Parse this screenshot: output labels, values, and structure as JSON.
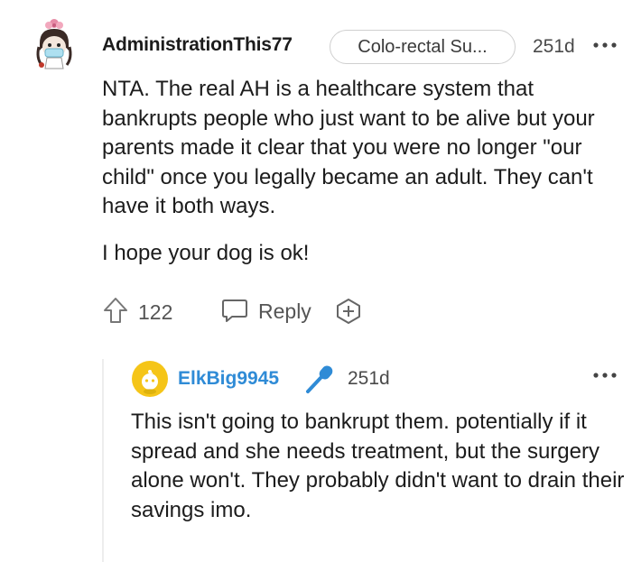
{
  "comment": {
    "username": "AdministrationThis77",
    "flair": "Colo-rectal Su...",
    "age": "251d",
    "more_icon": "ellipsis-icon",
    "paragraphs": [
      "NTA. The real AH is a healthcare system that bankrupts people who just want to be alive but your parents made it clear that you were no longer \"our child\" once you legally became an adult. They can't have it both ways.",
      "I hope your dog is ok!"
    ],
    "score": "122",
    "reply_label": "Reply",
    "colors": {
      "text": "#1c1c1c",
      "meta": "#555555"
    }
  },
  "reply": {
    "username": "ElkBig9945",
    "age": "251d",
    "badge_icon": "microphone-icon",
    "text": "This isn't going to bankrupt them. potentially if it spread and she needs treatment, but the surgery alone won't. They probably didn't want to drain their savings imo.",
    "colors": {
      "username": "#2f8bd6",
      "avatar": "#f5c518"
    }
  }
}
